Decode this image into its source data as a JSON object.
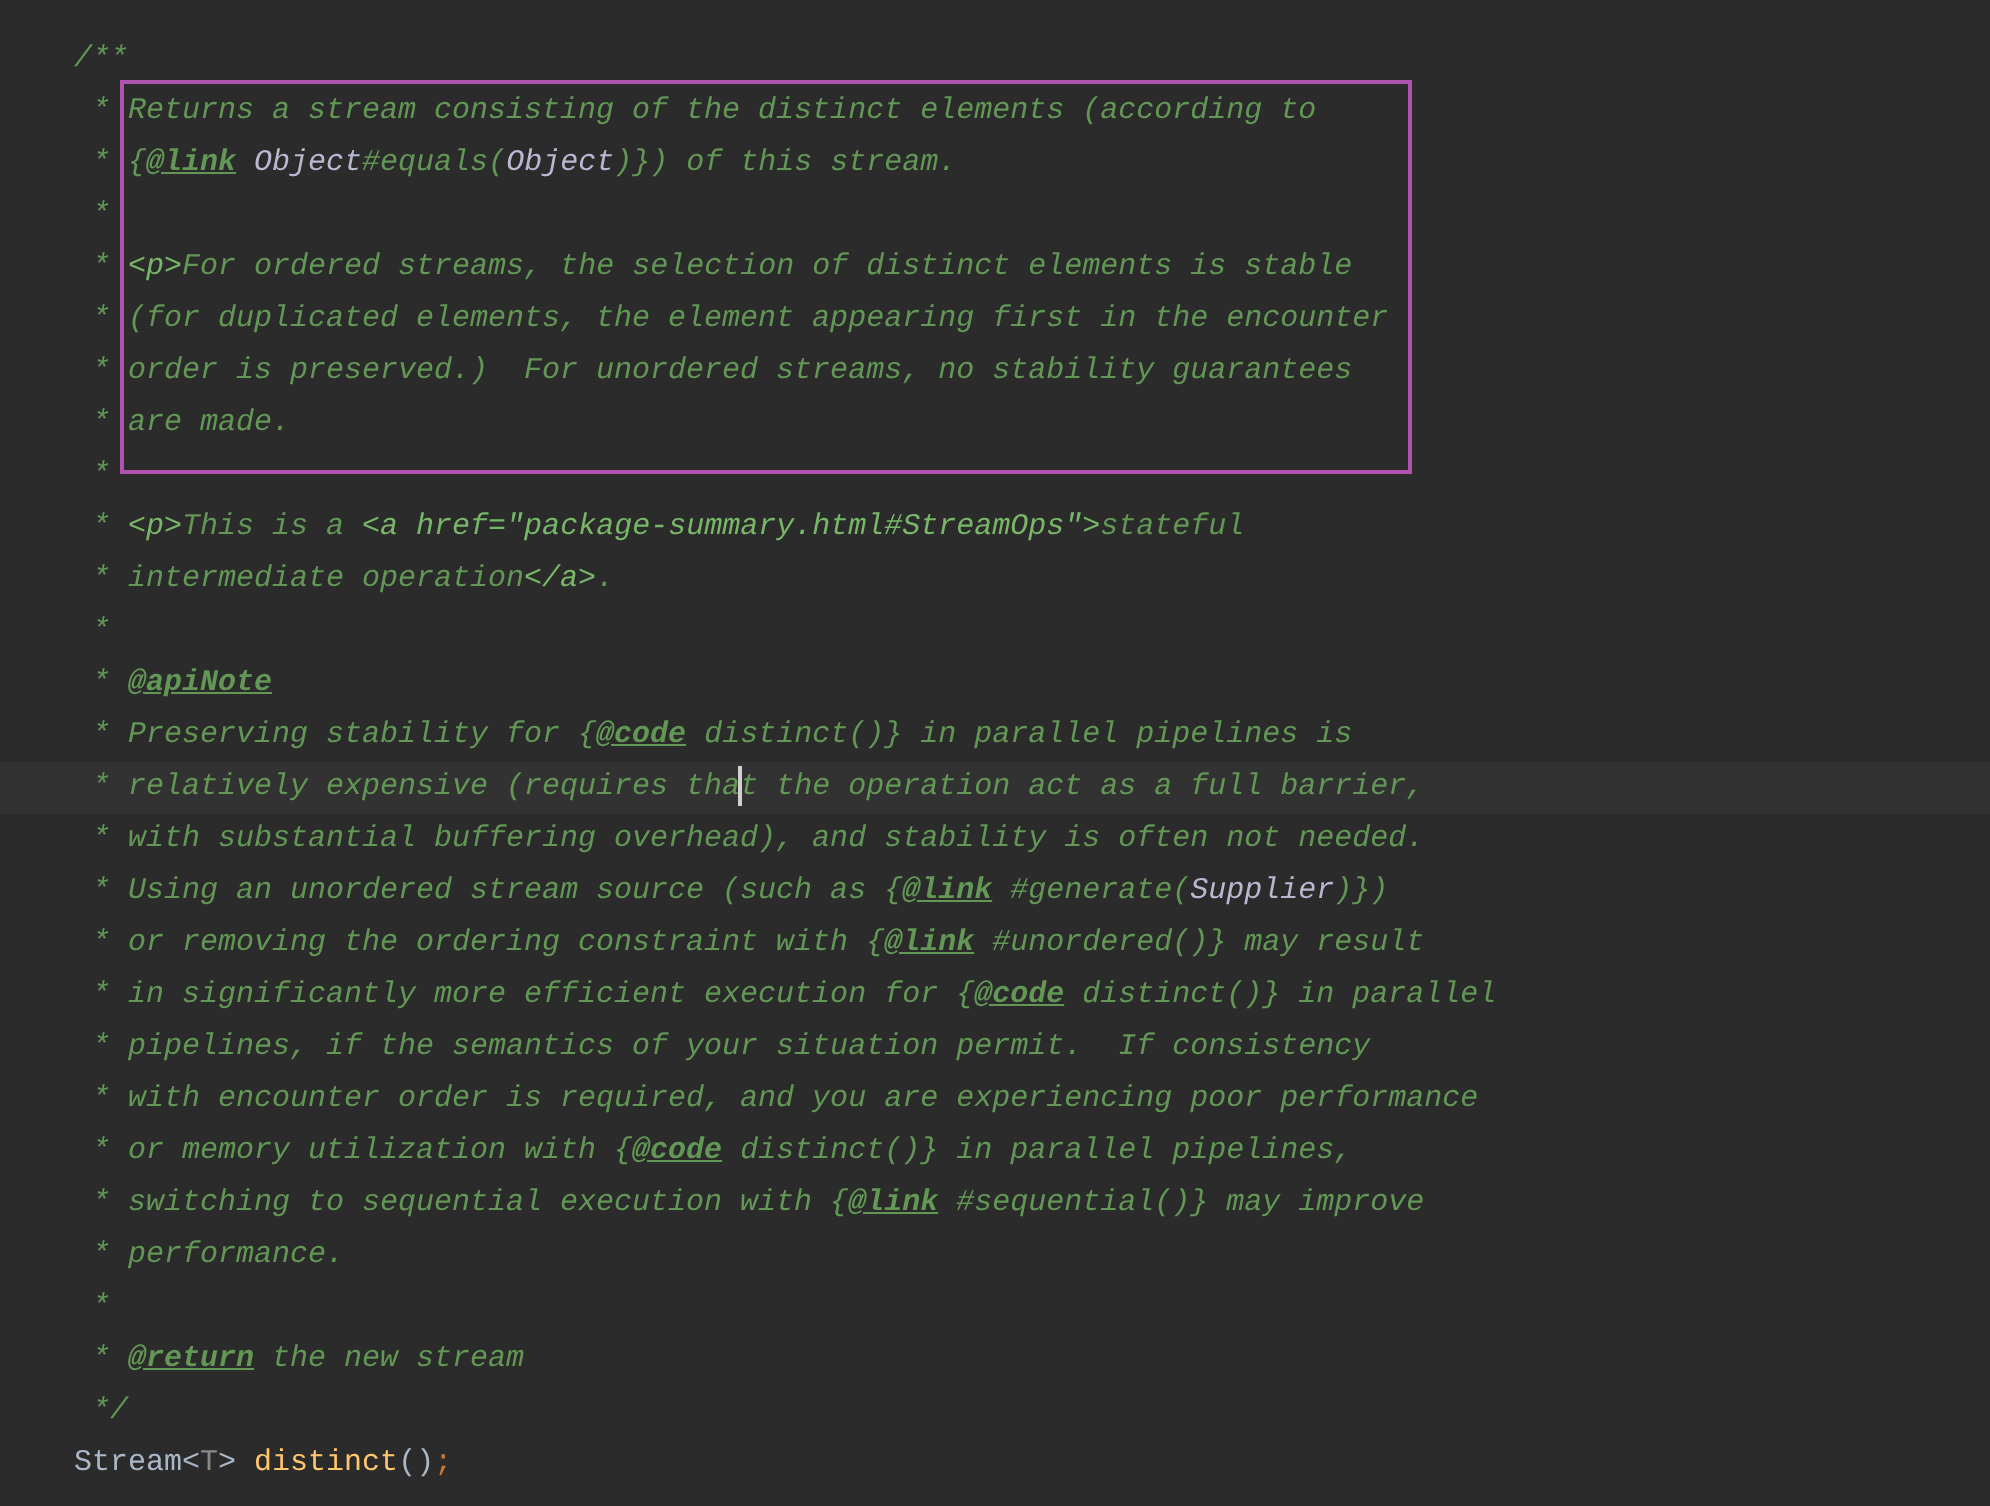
{
  "editor": {
    "blocks": [
      {
        "boxed": false,
        "lines": [
          {
            "kind": "comment",
            "segments": [
              {
                "kind": "text",
                "text": "/**"
              }
            ]
          }
        ]
      },
      {
        "boxed": true,
        "lines": [
          {
            "kind": "comment",
            "segments": [
              {
                "kind": "text",
                "text": " * Returns a stream consisting of the distinct elements (according to"
              }
            ]
          },
          {
            "kind": "comment",
            "segments": [
              {
                "kind": "text",
                "text": " * {"
              },
              {
                "kind": "tag",
                "text": "@link"
              },
              {
                "kind": "ref",
                "text": " Object"
              },
              {
                "kind": "text",
                "text": "#equals("
              },
              {
                "kind": "ref",
                "text": "Object"
              },
              {
                "kind": "text",
                "text": ")}) of this stream."
              }
            ]
          },
          {
            "kind": "comment",
            "segments": [
              {
                "kind": "text",
                "text": " *"
              }
            ]
          },
          {
            "kind": "comment",
            "segments": [
              {
                "kind": "text",
                "text": " * "
              },
              {
                "kind": "markup",
                "text": "<p>"
              },
              {
                "kind": "text",
                "text": "For ordered streams, the selection of distinct elements is stable"
              }
            ]
          },
          {
            "kind": "comment",
            "segments": [
              {
                "kind": "text",
                "text": " * (for duplicated elements, the element appearing first in the encounter"
              }
            ]
          },
          {
            "kind": "comment",
            "segments": [
              {
                "kind": "text",
                "text": " * order is preserved.)  For unordered streams, no stability guarantees"
              }
            ]
          },
          {
            "kind": "comment",
            "segments": [
              {
                "kind": "text",
                "text": " * are made."
              }
            ]
          }
        ]
      },
      {
        "boxed": false,
        "lines": [
          {
            "kind": "comment",
            "segments": [
              {
                "kind": "text",
                "text": " *"
              }
            ]
          },
          {
            "kind": "comment",
            "segments": [
              {
                "kind": "text",
                "text": " * "
              },
              {
                "kind": "markup",
                "text": "<p>"
              },
              {
                "kind": "text",
                "text": "This is a "
              },
              {
                "kind": "markup",
                "text": "<a href=\"package-summary.html#StreamOps\">"
              },
              {
                "kind": "text",
                "text": "stateful"
              }
            ]
          },
          {
            "kind": "comment",
            "segments": [
              {
                "kind": "text",
                "text": " * intermediate operation"
              },
              {
                "kind": "markup",
                "text": "</a>"
              },
              {
                "kind": "text",
                "text": "."
              }
            ]
          },
          {
            "kind": "comment",
            "segments": [
              {
                "kind": "text",
                "text": " *"
              }
            ]
          },
          {
            "kind": "comment",
            "segments": [
              {
                "kind": "text",
                "text": " * "
              },
              {
                "kind": "tag",
                "text": "@apiNote"
              }
            ]
          },
          {
            "kind": "comment",
            "segments": [
              {
                "kind": "text",
                "text": " * Preserving stability for {"
              },
              {
                "kind": "tag",
                "text": "@code"
              },
              {
                "kind": "text",
                "text": " distinct()} in parallel pipelines is"
              }
            ]
          },
          {
            "kind": "current_comment",
            "segments": [
              {
                "kind": "text",
                "text": " * relatively expensive (requires tha"
              },
              {
                "kind": "caret"
              },
              {
                "kind": "text",
                "text": "t the operation act as a full barrier,"
              }
            ]
          },
          {
            "kind": "comment",
            "segments": [
              {
                "kind": "text",
                "text": " * with substantial buffering overhead), and stability is often not needed."
              }
            ]
          },
          {
            "kind": "comment",
            "segments": [
              {
                "kind": "text",
                "text": " * Using an unordered stream source (such as {"
              },
              {
                "kind": "tag",
                "text": "@link"
              },
              {
                "kind": "text",
                "text": " #generate("
              },
              {
                "kind": "ref",
                "text": "Supplier"
              },
              {
                "kind": "text",
                "text": ")})"
              }
            ]
          },
          {
            "kind": "comment",
            "segments": [
              {
                "kind": "text",
                "text": " * or removing the ordering constraint with {"
              },
              {
                "kind": "tag",
                "text": "@link"
              },
              {
                "kind": "text",
                "text": " #unordered()} may result"
              }
            ]
          },
          {
            "kind": "comment",
            "segments": [
              {
                "kind": "text",
                "text": " * in significantly more efficient execution for {"
              },
              {
                "kind": "tag",
                "text": "@code"
              },
              {
                "kind": "text",
                "text": " distinct()} in parallel"
              }
            ]
          },
          {
            "kind": "comment",
            "segments": [
              {
                "kind": "text",
                "text": " * pipelines, if the semantics of your situation permit.  If consistency"
              }
            ]
          },
          {
            "kind": "comment",
            "segments": [
              {
                "kind": "text",
                "text": " * with encounter order is required, and you are experiencing poor performance"
              }
            ]
          },
          {
            "kind": "comment",
            "segments": [
              {
                "kind": "text",
                "text": " * or memory utilization with {"
              },
              {
                "kind": "tag",
                "text": "@code"
              },
              {
                "kind": "text",
                "text": " distinct()} in parallel pipelines,"
              }
            ]
          },
          {
            "kind": "comment",
            "segments": [
              {
                "kind": "text",
                "text": " * switching to sequential execution with {"
              },
              {
                "kind": "tag",
                "text": "@link"
              },
              {
                "kind": "text",
                "text": " #sequential()} may improve"
              }
            ]
          },
          {
            "kind": "comment",
            "segments": [
              {
                "kind": "text",
                "text": " * performance."
              }
            ]
          },
          {
            "kind": "comment",
            "segments": [
              {
                "kind": "text",
                "text": " *"
              }
            ]
          },
          {
            "kind": "comment",
            "segments": [
              {
                "kind": "text",
                "text": " * "
              },
              {
                "kind": "tag",
                "text": "@return"
              },
              {
                "kind": "text",
                "text": " the new stream"
              }
            ]
          },
          {
            "kind": "comment",
            "segments": [
              {
                "kind": "text",
                "text": " */"
              }
            ]
          },
          {
            "kind": "code",
            "segments": [
              {
                "kind": "type",
                "text": "Stream<"
              },
              {
                "kind": "type_param",
                "text": "T"
              },
              {
                "kind": "type",
                "text": "> "
              },
              {
                "kind": "method",
                "text": "distinct"
              },
              {
                "kind": "type",
                "text": "()"
              },
              {
                "kind": "punct",
                "text": ";"
              }
            ]
          }
        ]
      }
    ]
  }
}
